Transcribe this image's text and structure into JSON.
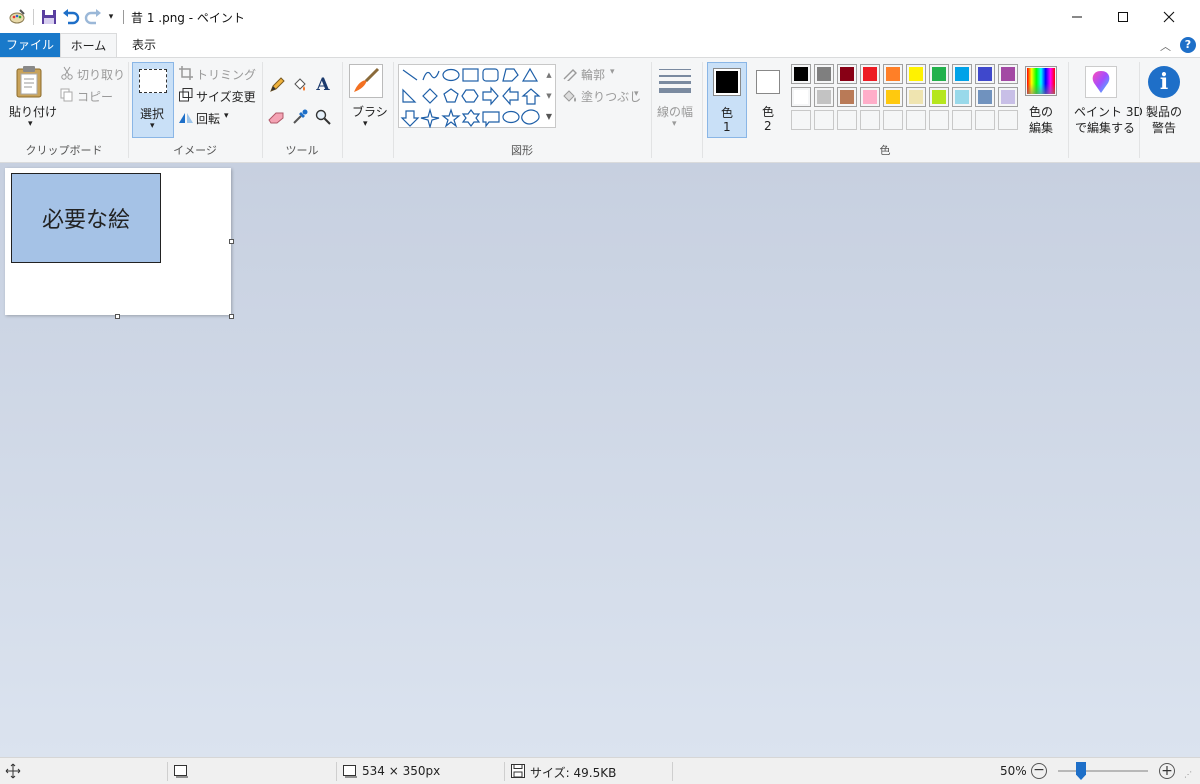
{
  "window": {
    "title": "昔 1 .png - ペイント",
    "icons": {
      "app": "paint-app-icon",
      "save": "save-icon",
      "undo": "undo-icon",
      "redo": "redo-icon",
      "customize": "dropdown-icon"
    }
  },
  "tabs": {
    "file": "ファイル",
    "home": "ホーム",
    "view": "表示"
  },
  "ribbon": {
    "clipboard": {
      "paste": "貼り付け",
      "cut": "切り取り",
      "copy": "コピー",
      "label": "クリップボード"
    },
    "image": {
      "select": "選択",
      "crop": "トリミング",
      "resize": "サイズ変更",
      "rotate": "回転",
      "label": "イメージ"
    },
    "tools": {
      "label": "ツール"
    },
    "brush": {
      "label": "ブラシ"
    },
    "shapes": {
      "outline": "輪郭",
      "fill": "塗りつぶし",
      "label": "図形"
    },
    "size": {
      "label": "線の幅"
    },
    "colors": {
      "color1": "色",
      "color1_num": "1",
      "color2": "色",
      "color2_num": "2",
      "edit_line1": "色の",
      "edit_line2": "編集",
      "label": "色",
      "row1": [
        "#000000",
        "#7f7f7f",
        "#880015",
        "#ed1c24",
        "#ff7f27",
        "#fff200",
        "#22b14c",
        "#00a2e8",
        "#3f48cc",
        "#a349a4"
      ],
      "row2": [
        "#ffffff",
        "#c3c3c3",
        "#b97a57",
        "#ffaec9",
        "#ffc90e",
        "#efe4b0",
        "#b5e61d",
        "#99d9ea",
        "#7092be",
        "#c8bfe7"
      ]
    },
    "paint3d": {
      "line1": "ペイント 3D",
      "line2": "で編集する"
    },
    "product": {
      "line1": "製品の",
      "line2": "警告"
    }
  },
  "canvas": {
    "text": "必要な絵"
  },
  "status": {
    "dimensions": "534 × 350px",
    "size": "サイズ: 49.5KB",
    "zoom": "50%"
  }
}
